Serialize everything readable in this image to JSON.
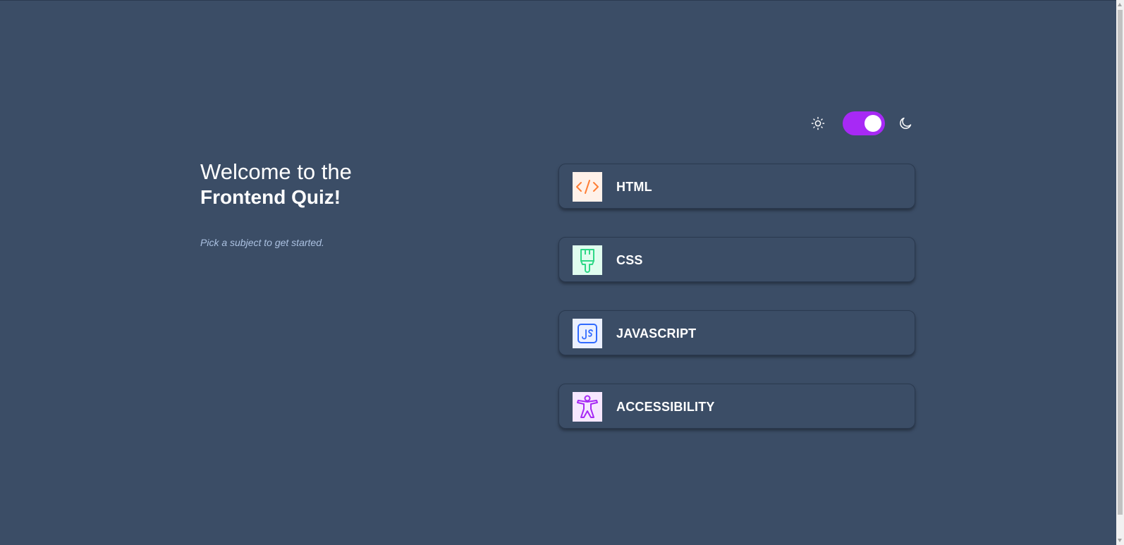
{
  "theme": {
    "mode": "dark",
    "background": "#3b4d66",
    "accent": "#a729f5",
    "toggle_on": true,
    "sun_icon": "sun-icon",
    "moon_icon": "moon-icon"
  },
  "welcome": {
    "line1": "Welcome to the",
    "line2": "Frontend Quiz!",
    "subtitle": "Pick a subject to get started."
  },
  "subjects": [
    {
      "label": "HTML",
      "icon": "html-icon",
      "icon_bg": "#fff1e9",
      "icon_color": "#ff7e35"
    },
    {
      "label": "CSS",
      "icon": "css-icon",
      "icon_bg": "#e0fdef",
      "icon_color": "#2fd887"
    },
    {
      "label": "JAVASCRIPT",
      "icon": "javascript-icon",
      "icon_bg": "#ebf0ff",
      "icon_color": "#306aff"
    },
    {
      "label": "ACCESSIBILITY",
      "icon": "accessibility-icon",
      "icon_bg": "#f6e7ff",
      "icon_color": "#a729f5"
    }
  ]
}
